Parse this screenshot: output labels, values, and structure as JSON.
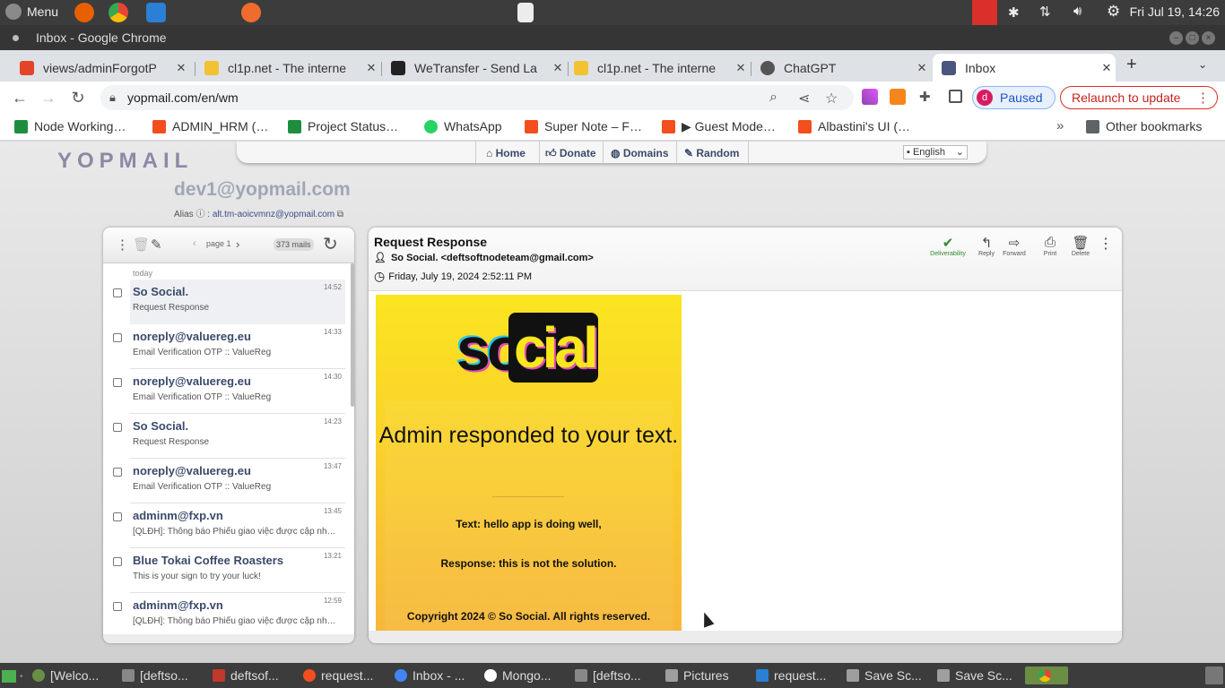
{
  "system": {
    "menu_label": "Menu",
    "clock": "Fri Jul 19, 14:26"
  },
  "window": {
    "title": "Inbox - Google Chrome"
  },
  "tabs": [
    {
      "label": "views/adminForgotP",
      "icon_color": "#e24329"
    },
    {
      "label": "cl1p.net - The interne",
      "icon_color": "#f2c230"
    },
    {
      "label": "WeTransfer - Send La",
      "icon_color": "#222222"
    },
    {
      "label": "cl1p.net - The interne",
      "icon_color": "#f2c230"
    },
    {
      "label": "ChatGPT",
      "icon_color": "#555555"
    },
    {
      "label": "Inbox",
      "icon_color": "#4a5580"
    }
  ],
  "address": {
    "url": "yopmail.com/en/wm",
    "paused_label": "Paused",
    "profile_initial": "d",
    "relaunch_label": "Relaunch to update"
  },
  "bookmarks": [
    {
      "label": "Node Working…",
      "color": "#1e8e3e"
    },
    {
      "label": "ADMIN_HRM (…",
      "color": "#f24e1e"
    },
    {
      "label": "Project Status…",
      "color": "#1e8e3e"
    },
    {
      "label": "WhatsApp",
      "color": "#25d366"
    },
    {
      "label": "Super Note – F…",
      "color": "#f24e1e"
    },
    {
      "label": "▶ Guest Mode…",
      "color": "#f24e1e"
    },
    {
      "label": "Albastini's UI (…",
      "color": "#f24e1e"
    }
  ],
  "other_bookmarks": "Other bookmarks",
  "yopmail": {
    "logo": "YOPMAIL",
    "nav": {
      "home": "Home",
      "donate": "Donate",
      "domains": "Domains",
      "random": "Random",
      "language": "English"
    },
    "address": "dev1@yopmail.com",
    "alias_label": "Alias",
    "alias_value": "alt.tm-aoicvmnz@yopmail.com"
  },
  "list": {
    "page_label": "page 1",
    "mail_count": "373 mails",
    "group": "today",
    "mails": [
      {
        "from": "So Social.",
        "subject": "Request Response",
        "time": "14:52"
      },
      {
        "from": "noreply@valuereg.eu",
        "subject": "Email Verification OTP :: ValueReg",
        "time": "14:33"
      },
      {
        "from": "noreply@valuereg.eu",
        "subject": "Email Verification OTP :: ValueReg",
        "time": "14:30"
      },
      {
        "from": "So Social.",
        "subject": "Request Response",
        "time": "14:23"
      },
      {
        "from": "noreply@valuereg.eu",
        "subject": "Email Verification OTP :: ValueReg",
        "time": "13:47"
      },
      {
        "from": "adminm@fxp.vn",
        "subject": "[QLĐH]: Thông báo Phiếu giao việc được cập nhật t...",
        "time": "13:45"
      },
      {
        "from": "Blue Tokai Coffee Roasters",
        "subject": "This is your sign to try your luck!",
        "time": "13:21"
      },
      {
        "from": "adminm@fxp.vn",
        "subject": "[QLĐH]: Thông báo Phiếu giao việc được cập nhật t...",
        "time": "12:59"
      }
    ]
  },
  "mail": {
    "subject": "Request Response",
    "sender": "So Social. <deftsoftnodeteam@gmail.com>",
    "date": "Friday, July 19, 2024 2:52:11 PM",
    "actions": {
      "deliverability": "Deliverability",
      "reply": "Reply",
      "forward": "Forward",
      "print": "Print",
      "delete": "Delete"
    },
    "body": {
      "logo_left": "so",
      "logo_right": "cial",
      "heading": "Admin responded to your text.",
      "text_line": "Text: hello app is doing well,",
      "response_line": "Response: this is not the solution.",
      "copyright": "Copyright 2024 © So Social. All rights reserved."
    }
  },
  "taskbar": [
    {
      "label": "[Welco...",
      "color": "#6a8f44"
    },
    {
      "label": "[deftso...",
      "color": "#888888"
    },
    {
      "label": "deftsof...",
      "color": "#c0392b"
    },
    {
      "label": "request...",
      "color": "#f24e1e"
    },
    {
      "label": "Inbox - ...",
      "color": "#4285f4"
    },
    {
      "label": "Mongo...",
      "color": "#ffffff"
    },
    {
      "label": "[deftso...",
      "color": "#888888"
    },
    {
      "label": "Pictures",
      "color": "#9e9e9e"
    },
    {
      "label": "request...",
      "color": "#2b7fd4"
    },
    {
      "label": "Save Sc...",
      "color": "#9e9e9e"
    },
    {
      "label": "Save Sc...",
      "color": "#9e9e9e"
    }
  ]
}
